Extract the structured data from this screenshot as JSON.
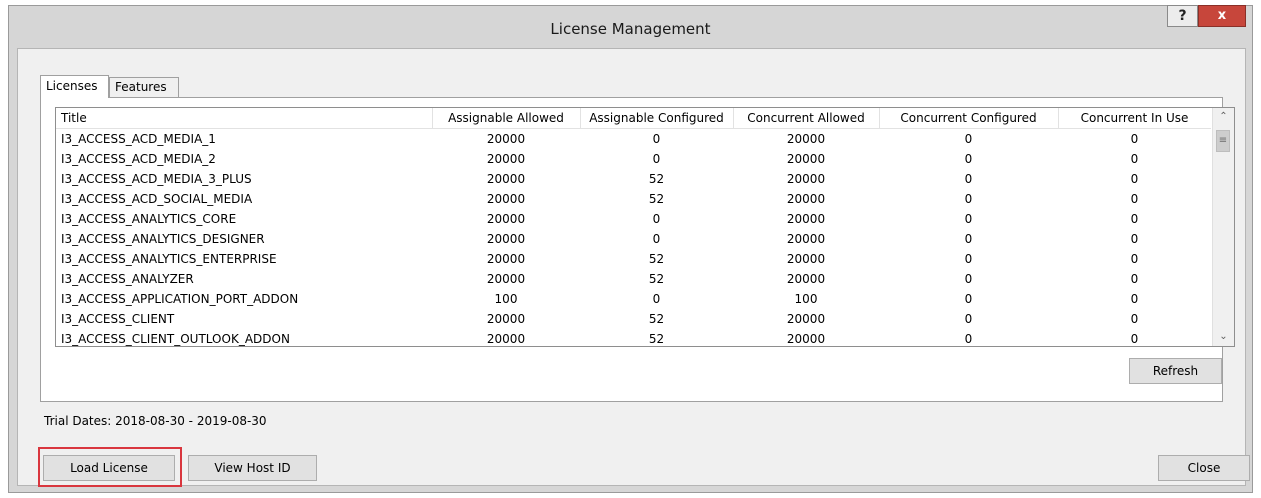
{
  "window": {
    "title": "License Management",
    "help_label": "?",
    "close_label": "x"
  },
  "tabs": [
    {
      "label": "Licenses",
      "active": true
    },
    {
      "label": "Features",
      "active": false
    }
  ],
  "table": {
    "columns": [
      "Title",
      "Assignable Allowed",
      "Assignable Configured",
      "Concurrent Allowed",
      "Concurrent Configured",
      "Concurrent In Use"
    ],
    "rows": [
      [
        "I3_ACCESS_ACD_MEDIA_1",
        "20000",
        "0",
        "20000",
        "0",
        "0"
      ],
      [
        "I3_ACCESS_ACD_MEDIA_2",
        "20000",
        "0",
        "20000",
        "0",
        "0"
      ],
      [
        "I3_ACCESS_ACD_MEDIA_3_PLUS",
        "20000",
        "52",
        "20000",
        "0",
        "0"
      ],
      [
        "I3_ACCESS_ACD_SOCIAL_MEDIA",
        "20000",
        "52",
        "20000",
        "0",
        "0"
      ],
      [
        "I3_ACCESS_ANALYTICS_CORE",
        "20000",
        "0",
        "20000",
        "0",
        "0"
      ],
      [
        "I3_ACCESS_ANALYTICS_DESIGNER",
        "20000",
        "0",
        "20000",
        "0",
        "0"
      ],
      [
        "I3_ACCESS_ANALYTICS_ENTERPRISE",
        "20000",
        "52",
        "20000",
        "0",
        "0"
      ],
      [
        "I3_ACCESS_ANALYZER",
        "20000",
        "52",
        "20000",
        "0",
        "0"
      ],
      [
        "I3_ACCESS_APPLICATION_PORT_ADDON",
        "100",
        "0",
        "100",
        "0",
        "0"
      ],
      [
        "I3_ACCESS_CLIENT",
        "20000",
        "52",
        "20000",
        "0",
        "0"
      ],
      [
        "I3_ACCESS_CLIENT_OUTLOOK_ADDON",
        "20000",
        "52",
        "20000",
        "0",
        "0"
      ]
    ]
  },
  "scrollbar": {
    "up_icon": "chevron-up-icon",
    "down_icon": "chevron-down-icon",
    "up_glyph": "⌃",
    "down_glyph": "⌄",
    "thumb_glyph": "≡"
  },
  "buttons": {
    "refresh": "Refresh",
    "load_license": "Load License",
    "view_host_id": "View Host ID",
    "close": "Close"
  },
  "trial_dates": "Trial Dates: 2018-08-30 - 2019-08-30",
  "colors": {
    "highlight": "#d9363e",
    "close_button": "#c7463b"
  }
}
